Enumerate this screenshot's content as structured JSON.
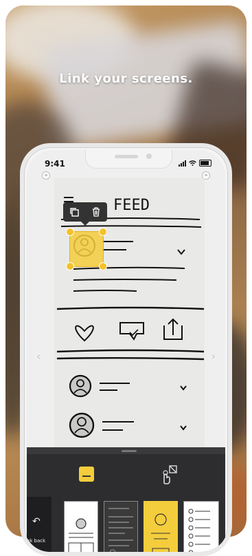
{
  "headline": "Link your screens.",
  "status": {
    "time": "9:41"
  },
  "sketch": {
    "title": "FEED"
  },
  "toolbar": {
    "link_back_label": "Link back"
  },
  "colors": {
    "accent_yellow": "#F4CD3C",
    "toolbar_bg": "#2D2D2F"
  }
}
